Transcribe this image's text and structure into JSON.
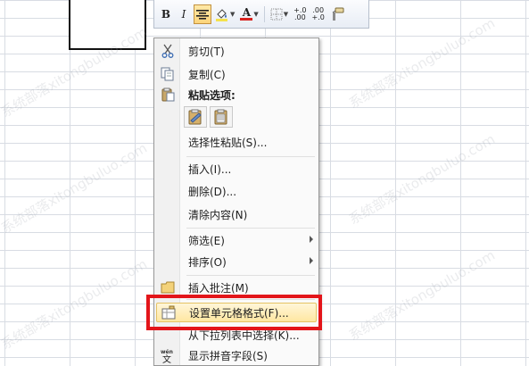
{
  "toolbar": {
    "bold_label": "B",
    "italic_label": "I",
    "font_color_label": "A",
    "inc_decimal_label": "+.0",
    "inc_decimal_sub": ".00",
    "dec_decimal_label": ".00",
    "dec_decimal_sub": "+.0",
    "icons": [
      "align-center-icon",
      "fill-color-icon",
      "font-color-icon",
      "borders-icon",
      "format-painter-icon"
    ]
  },
  "context_menu": {
    "items": [
      {
        "label": "剪切(T)",
        "icon": "scissors-icon"
      },
      {
        "label": "复制(C)",
        "icon": "copy-icon"
      },
      {
        "label": "粘贴选项:",
        "icon": "paste-icon"
      },
      {
        "label": "选择性粘贴(S)...",
        "icon": ""
      },
      {
        "label": "插入(I)...",
        "icon": ""
      },
      {
        "label": "删除(D)...",
        "icon": ""
      },
      {
        "label": "清除内容(N)",
        "icon": ""
      },
      {
        "label": "筛选(E)",
        "icon": "",
        "submenu": true
      },
      {
        "label": "排序(O)",
        "icon": "",
        "submenu": true
      },
      {
        "label": "插入批注(M)",
        "icon": "comment-icon"
      },
      {
        "label": "设置单元格格式(F)...",
        "icon": "format-cells-icon",
        "highlighted": true
      },
      {
        "label": "从下拉列表中选择(K)...",
        "icon": ""
      },
      {
        "label": "显示拼音字段(S)",
        "icon": "phonetic-icon"
      }
    ],
    "paste_options": [
      "paste-option-keep-formatting-icon",
      "paste-option-values-icon"
    ]
  },
  "watermark": {
    "text": "系统部落xitongbuluo.com"
  },
  "colors": {
    "highlight_border": "#e3151a",
    "hover_fill": "#ffe7a1",
    "grid_line": "#d8dce3"
  }
}
